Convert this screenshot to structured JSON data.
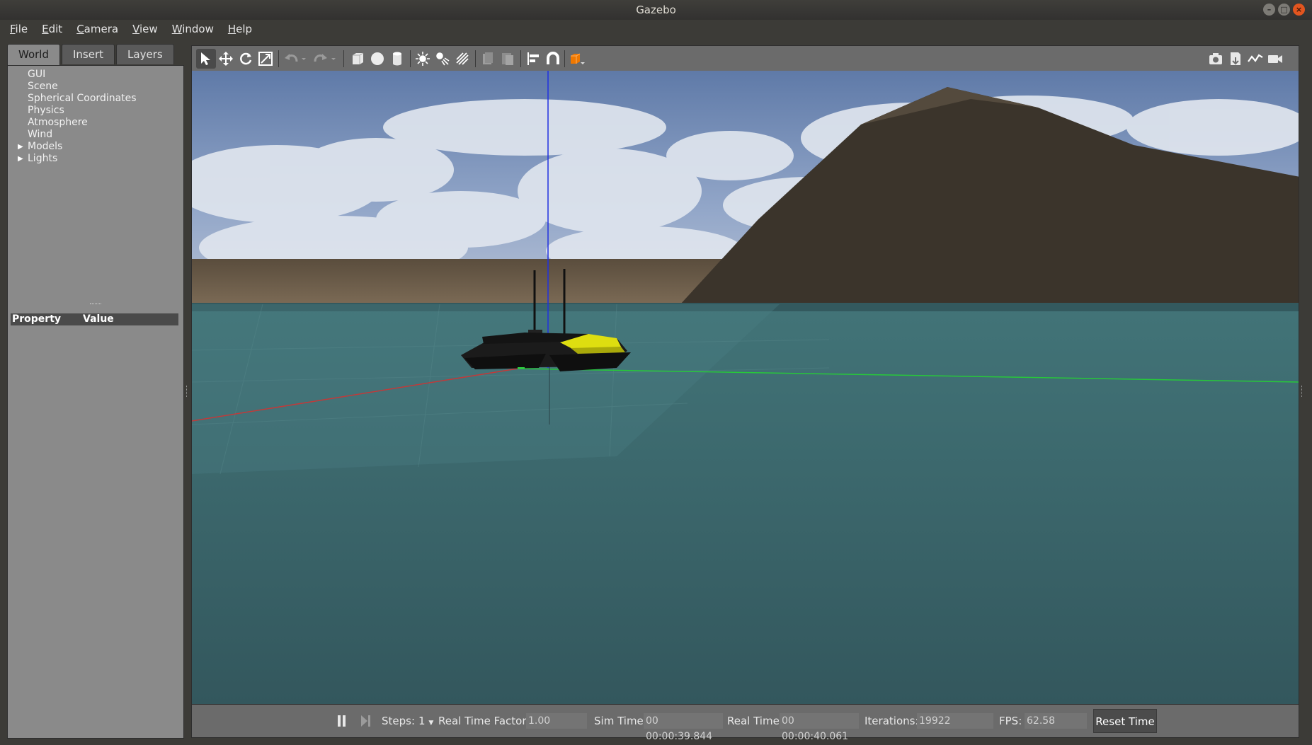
{
  "window": {
    "title": "Gazebo"
  },
  "menu": {
    "file": {
      "u": "F",
      "rest": "ile"
    },
    "edit": {
      "u": "E",
      "rest": "dit"
    },
    "camera": {
      "u": "C",
      "rest": "amera"
    },
    "view": {
      "u": "V",
      "rest": "iew"
    },
    "window": {
      "u": "W",
      "rest": "indow"
    },
    "help": {
      "u": "H",
      "rest": "elp"
    }
  },
  "left_panel": {
    "tabs": [
      "World",
      "Insert",
      "Layers"
    ],
    "tree": [
      "GUI",
      "Scene",
      "Spherical Coordinates",
      "Physics",
      "Atmosphere",
      "Wind",
      "Models",
      "Lights"
    ],
    "property_header": {
      "property": "Property",
      "value": "Value"
    }
  },
  "toolbar": {
    "icons": [
      "select-arrow-icon",
      "translate-icon",
      "rotate-icon",
      "scale-icon",
      "undo-icon",
      "redo-icon",
      "box-icon",
      "sphere-icon",
      "cylinder-icon",
      "point-light-icon",
      "spot-light-icon",
      "directional-light-icon",
      "copy-icon",
      "paste-icon",
      "align-icon",
      "snap-icon",
      "view-angle-icon",
      "screenshot-icon",
      "log-icon",
      "plot-icon",
      "record-video-icon"
    ]
  },
  "bottom": {
    "steps_label": "Steps:",
    "steps_value": "1",
    "rtf_label": "Real Time Factor:",
    "rtf_value": "1.00",
    "sim_time_label": "Sim Time:",
    "sim_time_value": "00 00:00:39.844",
    "real_time_label": "Real Time:",
    "real_time_value": "00 00:00:40.061",
    "iterations_label": "Iterations:",
    "iterations_value": "19922",
    "fps_label": "FPS:",
    "fps_value": "62.58",
    "reset_label": "Reset Time"
  },
  "colors": {
    "sky": "#a9b9d6",
    "water": "#3a6a6e",
    "mountain": "#3a342c",
    "shore": "#6e5f4c",
    "boat_hull": "#1a1a1a",
    "boat_deck": "#e8e000",
    "axis_x": "#c03a3a",
    "axis_y": "#27c83a",
    "axis_z": "#2030e0"
  }
}
